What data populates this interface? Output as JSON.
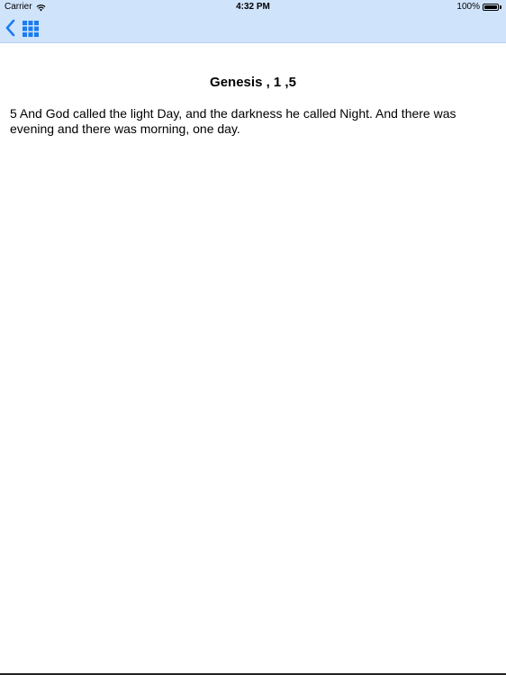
{
  "status_bar": {
    "carrier": "Carrier",
    "time": "4:32 PM",
    "battery": "100%"
  },
  "nav": {
    "back_icon": "chevron-left-icon",
    "grid_icon": "grid-icon",
    "accent_color": "#1a7cf0",
    "bar_color": "#cfe3fb"
  },
  "content": {
    "title": "Genesis , 1 ,5",
    "verse_text": "5 And God called the light Day, and the darkness he called Night. And there was evening and there was morning, one day."
  }
}
